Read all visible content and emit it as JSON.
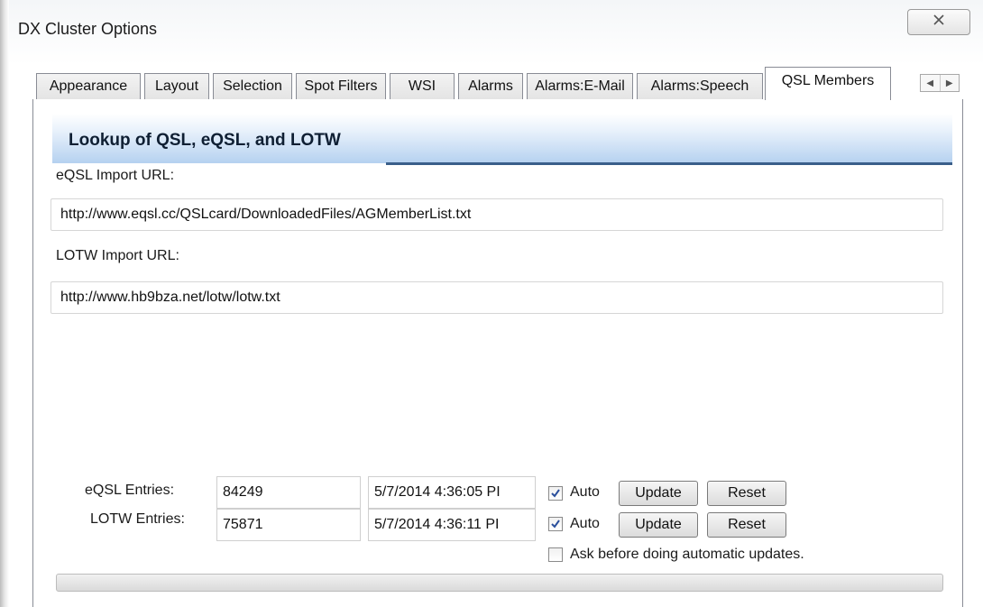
{
  "window": {
    "title": "DX Cluster Options",
    "close_icon": "close-icon"
  },
  "tabs": [
    {
      "label": "Appearance",
      "active": false
    },
    {
      "label": "Layout",
      "active": false
    },
    {
      "label": "Selection",
      "active": false
    },
    {
      "label": "Spot Filters",
      "active": false
    },
    {
      "label": "WSI",
      "active": false
    },
    {
      "label": "Alarms",
      "active": false
    },
    {
      "label": "Alarms:E-Mail",
      "active": false
    },
    {
      "label": "Alarms:Speech",
      "active": false
    },
    {
      "label": "QSL Members",
      "active": true
    }
  ],
  "tab_scroll": {
    "left_icon": "arrow-left-icon",
    "right_icon": "arrow-right-icon"
  },
  "panel": {
    "header": "Lookup of QSL, eQSL, and LOTW",
    "eqsl_url_label": "eQSL Import URL:",
    "eqsl_url_value": "http://www.eqsl.cc/QSLcard/DownloadedFiles/AGMemberList.txt",
    "lotw_url_label": "LOTW Import URL:",
    "lotw_url_value": "http://www.hb9bza.net/lotw/lotw.txt"
  },
  "entries": {
    "eqsl": {
      "label": "eQSL Entries:",
      "count": "84249",
      "timestamp": "5/7/2014 4:36:05 PI",
      "auto_label": "Auto",
      "auto_checked": true,
      "update_label": "Update",
      "reset_label": "Reset"
    },
    "lotw": {
      "label": "LOTW Entries:",
      "count": "75871",
      "timestamp": "5/7/2014 4:36:11 PI",
      "auto_label": "Auto",
      "auto_checked": true,
      "update_label": "Update",
      "reset_label": "Reset"
    },
    "ask_label": "Ask before doing automatic updates.",
    "ask_checked": false
  },
  "progress": {
    "value_fraction": 0
  }
}
